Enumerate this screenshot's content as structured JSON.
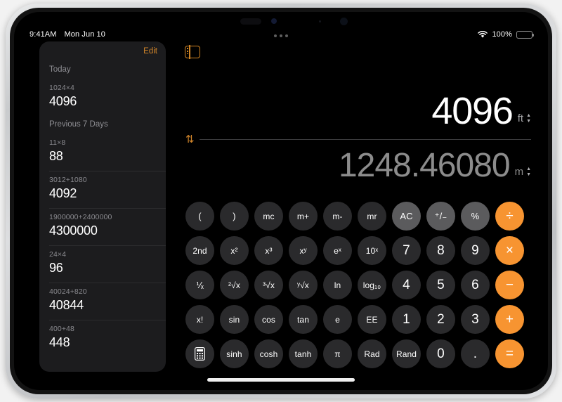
{
  "status_bar": {
    "time": "9:41AM",
    "date": "Mon Jun 10",
    "battery_percent": "100%",
    "wifi_icon": "wifi-icon",
    "battery_icon": "battery-icon"
  },
  "sidebar_toggle": {
    "icon": "sidebar-toggle-icon",
    "accent": "#d08424"
  },
  "history": {
    "edit_label": "Edit",
    "sections": [
      {
        "title": "Today",
        "items": [
          {
            "expression": "1024×4",
            "result": "4096"
          }
        ]
      },
      {
        "title": "Previous 7 Days",
        "items": [
          {
            "expression": "11×8",
            "result": "88"
          },
          {
            "expression": "3012+1080",
            "result": "4092"
          },
          {
            "expression": "1900000+2400000",
            "result": "4300000"
          },
          {
            "expression": "24×4",
            "result": "96"
          },
          {
            "expression": "40024+820",
            "result": "40844"
          },
          {
            "expression": "400+48",
            "result": "448"
          }
        ]
      }
    ]
  },
  "display": {
    "primary_value": "4096",
    "primary_unit": "ft",
    "secondary_value": "1248.46080",
    "secondary_unit": "m",
    "swap_icon": "⇅",
    "chevron_up": "▲",
    "chevron_down": "▼"
  },
  "keypad": {
    "rows": [
      [
        {
          "label": "(",
          "name": "paren-open",
          "style": "dark"
        },
        {
          "label": ")",
          "name": "paren-close",
          "style": "dark"
        },
        {
          "label": "mc",
          "name": "memory-clear",
          "style": "dark-small"
        },
        {
          "label": "m+",
          "name": "memory-add",
          "style": "dark-small"
        },
        {
          "label": "m-",
          "name": "memory-subtract",
          "style": "dark-small"
        },
        {
          "label": "mr",
          "name": "memory-recall",
          "style": "dark-small"
        },
        {
          "label": "AC",
          "name": "all-clear",
          "style": "light"
        },
        {
          "label": "⁺/₋",
          "name": "sign-toggle",
          "style": "light"
        },
        {
          "label": "%",
          "name": "percent",
          "style": "light"
        },
        {
          "label": "÷",
          "name": "divide",
          "style": "accent"
        }
      ],
      [
        {
          "label": "2nd",
          "name": "second-function",
          "style": "dark-small"
        },
        {
          "label": "x²",
          "name": "square",
          "style": "dark-small"
        },
        {
          "label": "x³",
          "name": "cube",
          "style": "dark-small"
        },
        {
          "label": "xʸ",
          "name": "power-y",
          "style": "dark-small"
        },
        {
          "label": "eˣ",
          "name": "exp-e",
          "style": "dark-small"
        },
        {
          "label": "10ˣ",
          "name": "exp-ten",
          "style": "dark-small"
        },
        {
          "label": "7",
          "name": "digit-7",
          "style": "digit"
        },
        {
          "label": "8",
          "name": "digit-8",
          "style": "digit"
        },
        {
          "label": "9",
          "name": "digit-9",
          "style": "digit"
        },
        {
          "label": "×",
          "name": "multiply",
          "style": "accent"
        }
      ],
      [
        {
          "label": "⅟ₓ",
          "name": "reciprocal",
          "style": "dark-small"
        },
        {
          "label": "²√x",
          "name": "square-root",
          "style": "dark-small"
        },
        {
          "label": "³√x",
          "name": "cube-root",
          "style": "dark-small"
        },
        {
          "label": "ʸ√x",
          "name": "nth-root",
          "style": "dark-small"
        },
        {
          "label": "ln",
          "name": "natural-log",
          "style": "dark-small"
        },
        {
          "label": "log₁₀",
          "name": "log-base-ten",
          "style": "dark-small"
        },
        {
          "label": "4",
          "name": "digit-4",
          "style": "digit"
        },
        {
          "label": "5",
          "name": "digit-5",
          "style": "digit"
        },
        {
          "label": "6",
          "name": "digit-6",
          "style": "digit"
        },
        {
          "label": "−",
          "name": "subtract",
          "style": "accent"
        }
      ],
      [
        {
          "label": "x!",
          "name": "factorial",
          "style": "dark-small"
        },
        {
          "label": "sin",
          "name": "sine",
          "style": "dark-small"
        },
        {
          "label": "cos",
          "name": "cosine",
          "style": "dark-small"
        },
        {
          "label": "tan",
          "name": "tangent",
          "style": "dark-small"
        },
        {
          "label": "e",
          "name": "euler-number",
          "style": "dark-small"
        },
        {
          "label": "EE",
          "name": "scientific-notation",
          "style": "dark-small"
        },
        {
          "label": "1",
          "name": "digit-1",
          "style": "digit"
        },
        {
          "label": "2",
          "name": "digit-2",
          "style": "digit"
        },
        {
          "label": "3",
          "name": "digit-3",
          "style": "digit"
        },
        {
          "label": "+",
          "name": "add",
          "style": "accent"
        }
      ],
      [
        {
          "label": "",
          "name": "calculator-mode-icon",
          "style": "icon-calc"
        },
        {
          "label": "sinh",
          "name": "hyperbolic-sine",
          "style": "dark-small"
        },
        {
          "label": "cosh",
          "name": "hyperbolic-cosine",
          "style": "dark-small"
        },
        {
          "label": "tanh",
          "name": "hyperbolic-tangent",
          "style": "dark-small"
        },
        {
          "label": "π",
          "name": "pi",
          "style": "dark-small"
        },
        {
          "label": "Rad",
          "name": "radians-toggle",
          "style": "dark-small"
        },
        {
          "label": "Rand",
          "name": "random",
          "style": "dark-small"
        },
        {
          "label": "0",
          "name": "digit-0",
          "style": "digit"
        },
        {
          "label": ".",
          "name": "decimal-point",
          "style": "digit"
        },
        {
          "label": "=",
          "name": "equals",
          "style": "accent"
        }
      ]
    ]
  },
  "colors": {
    "accent_orange": "#f79431",
    "key_dark": "#2a2a2c",
    "key_light": "#5b5b5d",
    "panel": "#1c1c1e"
  }
}
